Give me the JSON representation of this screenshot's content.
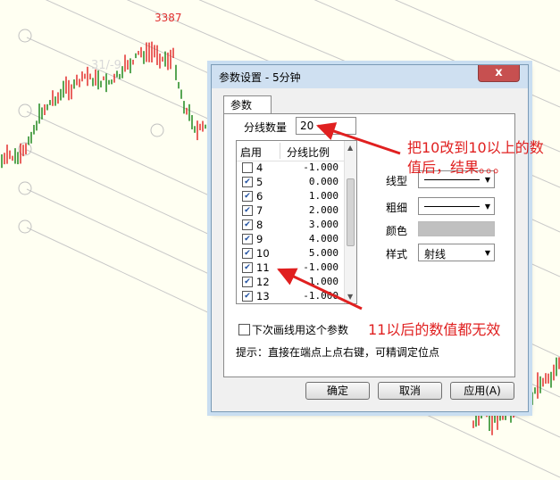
{
  "chart": {
    "peak_label": "3387",
    "watermark": "31/-9",
    "colors": {
      "background": "#fffff2",
      "up_candle": "#e02020",
      "down_candle": "#108010",
      "fan_line": "#c8c8c8"
    }
  },
  "dialog": {
    "title": "参数设置 - 5分钟",
    "close_glyph": "x",
    "tab_label": "参数",
    "count_label": "分线数量",
    "count_value": "20",
    "list": {
      "col_enable": "启用",
      "col_ratio": "分线比例",
      "rows": [
        {
          "id": "4",
          "checked": false,
          "ratio": "-1.000"
        },
        {
          "id": "5",
          "checked": true,
          "ratio": "0.000"
        },
        {
          "id": "6",
          "checked": true,
          "ratio": "1.000"
        },
        {
          "id": "7",
          "checked": true,
          "ratio": "2.000"
        },
        {
          "id": "8",
          "checked": true,
          "ratio": "3.000"
        },
        {
          "id": "9",
          "checked": true,
          "ratio": "4.000"
        },
        {
          "id": "10",
          "checked": true,
          "ratio": "5.000"
        },
        {
          "id": "11",
          "checked": true,
          "ratio": "-1.000"
        },
        {
          "id": "12",
          "checked": true,
          "ratio": "-1.000"
        },
        {
          "id": "13",
          "checked": true,
          "ratio": "-1.000"
        }
      ]
    },
    "line_type_label": "线型",
    "thickness_label": "粗细",
    "color_label": "颜色",
    "style_label": "样式",
    "style_value": "射线",
    "swatch_color": "#c0c0c0",
    "checkbox_label": "下次画线用这个参数",
    "hint": "提示：直接在端点上点右键，可精调定位点",
    "ok_label": "确定",
    "cancel_label": "取消",
    "apply_label": "应用(A)"
  },
  "annotations": {
    "top_line1": "把10改到10以上的数",
    "top_line2": "值后，结果。。。",
    "bottom": "11以后的数值都无效",
    "color": "#e02020"
  }
}
